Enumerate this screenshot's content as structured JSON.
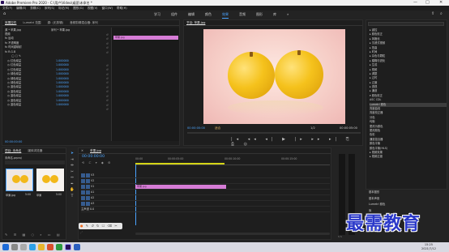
{
  "titlebar": {
    "title": "Adobe Premiere Pro 2020 - C:\\用户\\Video\\桌面\\未命名 *",
    "minimize": "—",
    "maximize": "□",
    "close": "✕"
  },
  "menu": [
    "文件(F)",
    "编辑(E)",
    "剪辑(C)",
    "序列(S)",
    "标记(M)",
    "图形(G)",
    "视图(V)",
    "窗口(W)",
    "帮助(H)"
  ],
  "workspaces": {
    "items": [
      "学习",
      "组件",
      "编辑",
      "颜色",
      "效果",
      "音频",
      "图形",
      "库"
    ],
    "active_index": 4,
    "more": "»"
  },
  "effect_controls": {
    "tabs": [
      "效果控件",
      "Lumetri 范围",
      "源: (无剪辑)",
      "音频剪辑混合器: 序列"
    ],
    "source_label": "源 * 苹果.jpg",
    "seq_label": "序列 * 苹果.jpg",
    "clip_label": "苹果.jpg",
    "sections": [
      "视频",
      "fx  运动",
      "fx  不透明度",
      "fx  时间重映射",
      "fx  R.G.B"
    ],
    "params": [
      {
        "name": "红色增益",
        "value": "1.000000"
      },
      {
        "name": "红色增益",
        "value": "1.000000"
      },
      {
        "name": "红色增益",
        "value": "1.000000"
      },
      {
        "name": "绿色增益",
        "value": "1.000000"
      },
      {
        "name": "绿色增益",
        "value": "1.000000"
      },
      {
        "name": "绿色增益",
        "value": "1.000000"
      },
      {
        "name": "蓝色增益",
        "value": "1.000000"
      },
      {
        "name": "蓝色增益",
        "value": "1.000000"
      },
      {
        "name": "蓝色增益",
        "value": "1.000000"
      },
      {
        "name": "蓝色增益",
        "value": "1.000000"
      },
      {
        "name": "蓝色增益",
        "value": "1.000000"
      }
    ],
    "timecode": "00:00:00:00"
  },
  "program_monitor": {
    "tab": "节目: 苹果.jpg",
    "timecode_left": "00:00:00:00",
    "fit": "适合",
    "quality": "1/2",
    "timecode_right": "00:00:05:00"
  },
  "project": {
    "tabs": [
      "项目: 未命名",
      "媒体浏览器"
    ],
    "file": "未命名.prproj",
    "items": [
      {
        "name": "苹果.jpg",
        "duration": "5:00"
      },
      {
        "name": "苹果",
        "duration": "5:00"
      }
    ]
  },
  "timeline": {
    "tab": "苹果.jpg",
    "timecode": "00:00:00:00",
    "ruler": [
      "00:00",
      "00:00:05:00",
      "00:00:10:00",
      "00:00:15:00"
    ],
    "tracks": [
      "V3",
      "V2",
      "V1",
      "A1",
      "A2",
      "A3"
    ],
    "master": "主声道",
    "master_value": "0.0",
    "clip_label": "苹果.jpg"
  },
  "effects_panel": {
    "items": [
      "▸ 键控",
      "▸ 颜色校正",
      "▸ 风格化",
      "▸ 沉浸式视频",
      "▸ 扭曲",
      "▸ 时间",
      "▸ 杂色与颗粒",
      "▸ 模糊与锐化",
      "▸ 生成",
      "▸ 视频",
      "▸ 调整",
      "▸ 过时",
      "▸ 过渡",
      "▸ 透视",
      "▸ 通道",
      "▾ 颜色校正",
      "  ASC CDL",
      "  Lumetri 颜色",
      "  亮度曲线",
      "  亮度校正器",
      "  分色",
      "  均衡",
      "  更改为颜色",
      "  更改颜色",
      "  色彩",
      "  通道混合器",
      "  颜色平衡",
      "  颜色平衡(HLS)",
      "▸ 视频效果",
      "▸ 视频过渡"
    ],
    "bottom_sections": [
      "基本图形",
      "基本声音",
      "Lumetri 颜色",
      "库",
      "标记",
      "历史记录",
      "信息"
    ]
  },
  "watermark": {
    "text": "最需教育"
  },
  "taskbar": {
    "time": "15:25",
    "date": "2021/7/12"
  },
  "colors": {
    "accent": "#4aa3ff",
    "clip": "#d67cd6",
    "watermark": "#2a38c9"
  }
}
